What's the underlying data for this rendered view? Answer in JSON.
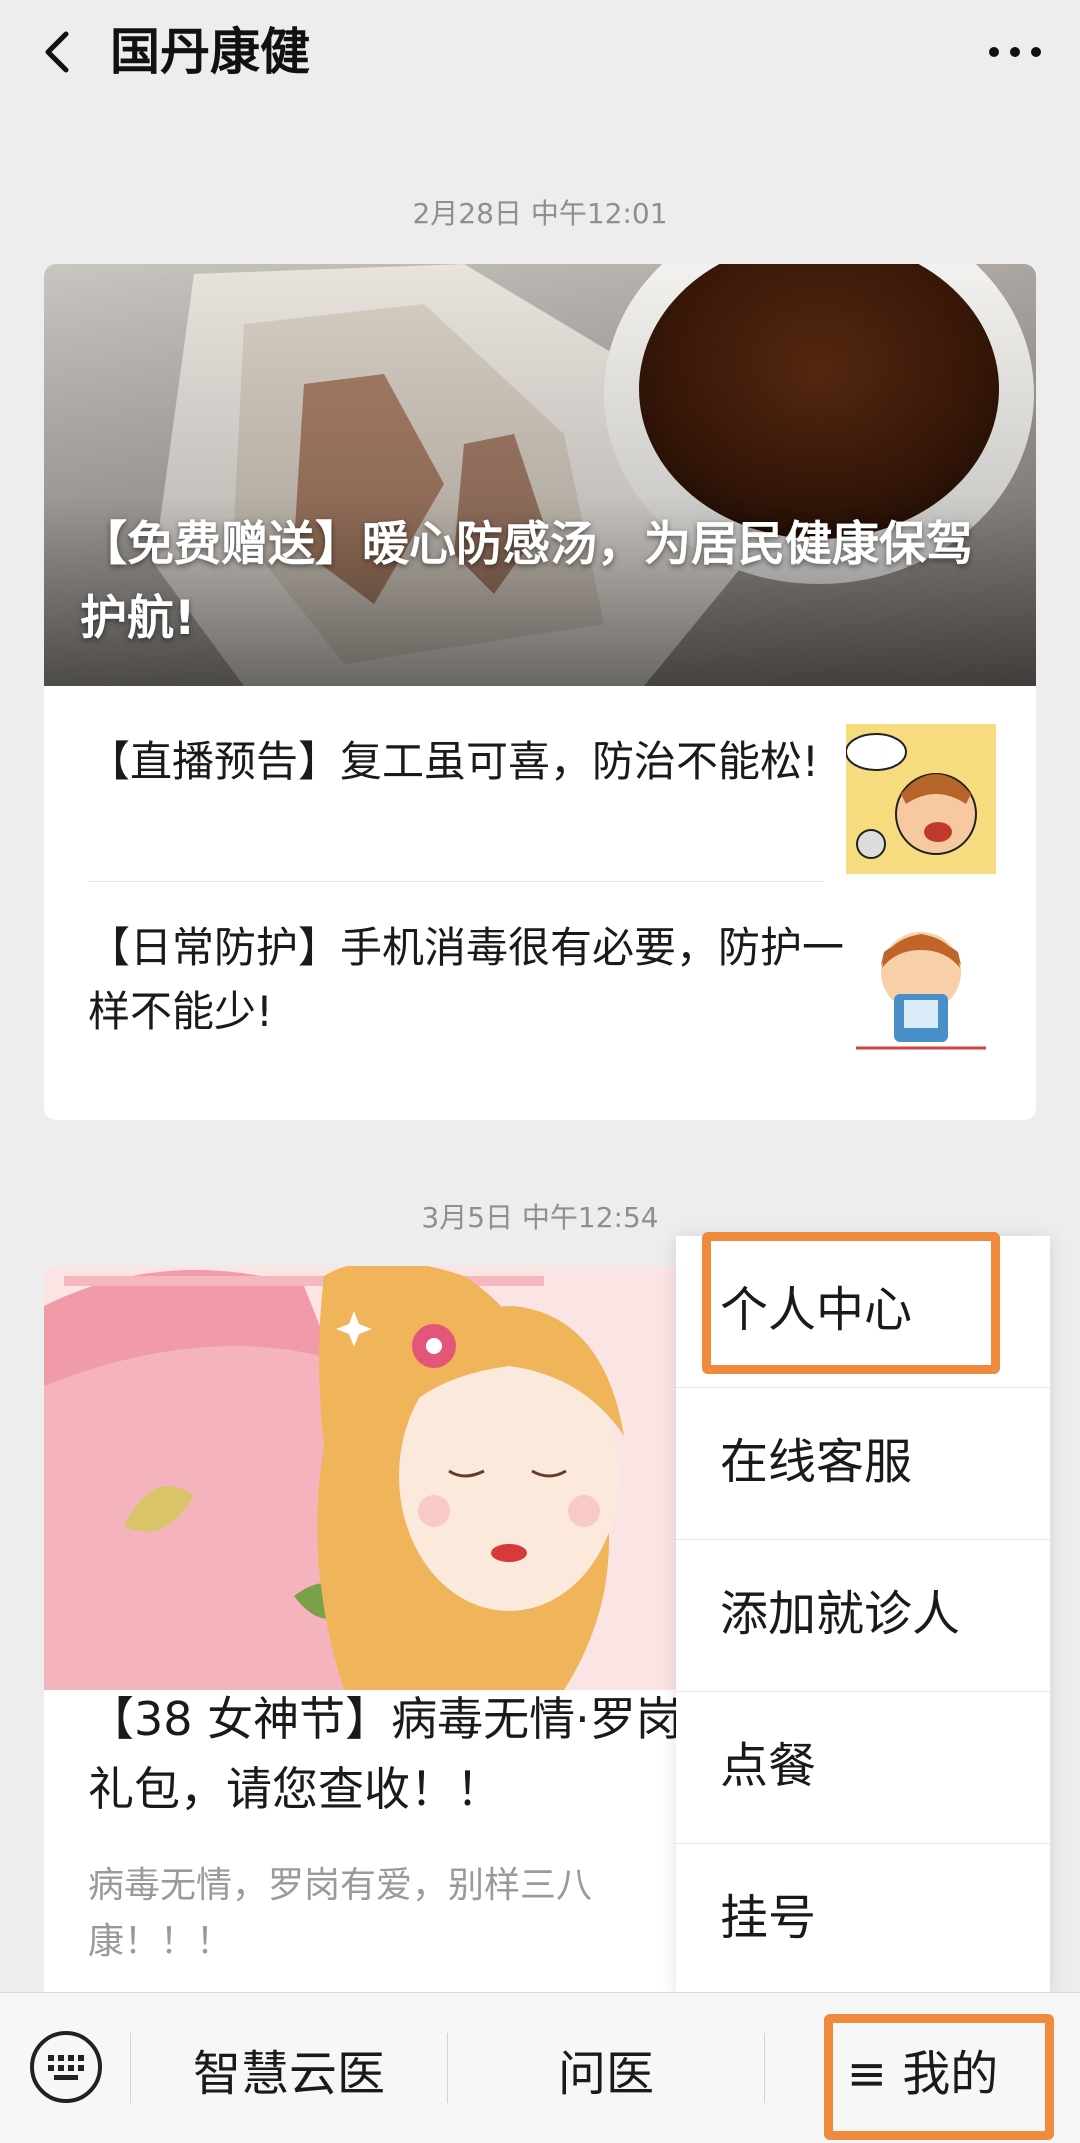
{
  "header": {
    "title": "国丹康健"
  },
  "messages": [
    {
      "timestamp": "2月28日 中午12:01",
      "main_title": "【免费赠送】暖心防感汤，为居民健康保驾护航!",
      "sub_items": [
        {
          "title": "【直播预告】复工虽可喜，防治不能松!"
        },
        {
          "title": "【日常防护】手机消毒很有必要，防护一样不能少!"
        }
      ]
    },
    {
      "timestamp": "3月5日 中午12:54",
      "title": "【38 女神节】病毒无情·罗岗",
      "title_line2": "礼包，请您查收！！",
      "digest": "病毒无情，罗岗有爱，别样三八",
      "digest_line2": "康！！！"
    }
  ],
  "popup_menu": {
    "items": [
      "个人中心",
      "在线客服",
      "添加就诊人",
      "点餐",
      "挂号"
    ]
  },
  "bottom_menu": {
    "items": [
      "智慧云医",
      "问医",
      "≡ 我的"
    ]
  },
  "colors": {
    "highlight": "#f08a3c",
    "background": "#ededed"
  }
}
